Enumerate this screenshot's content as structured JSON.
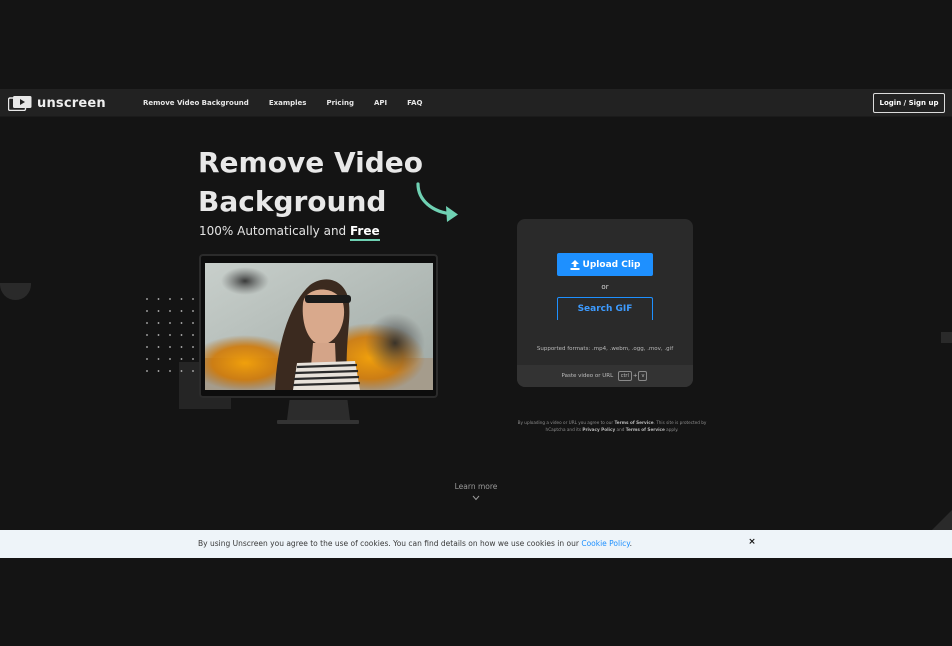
{
  "nav": {
    "logo_text": "unscreen",
    "links": [
      "Remove Video Background",
      "Examples",
      "Pricing",
      "API",
      "FAQ"
    ],
    "login_label": "Login / Sign up"
  },
  "hero": {
    "title": "Remove Video Background",
    "subtitle_prefix": "100% Automatically and ",
    "subtitle_free": "Free"
  },
  "upload": {
    "upload_label": "Upload Clip",
    "or_label": "or",
    "search_label": "Search GIF",
    "supported_formats": "Supported formats: .mp4, .webm, .ogg, .mov, .gif",
    "paste_prefix": "Paste video or URL",
    "key_ctrl": "ctrl",
    "key_plus": "+",
    "key_v": "v"
  },
  "terms": {
    "part1": "By uploading a video or URL you agree to our ",
    "terms_link": "Terms of Service",
    "part2": ". This site is protected by hCaptcha and its ",
    "privacy_link": "Privacy Policy",
    "part3": " and ",
    "terms_link2": "Terms of Service",
    "part4": " apply."
  },
  "learn_more": "Learn more",
  "cookie": {
    "text": "By using Unscreen you agree to the use of cookies. You can find details on how we use cookies in our ",
    "link": "Cookie Policy",
    "suffix": ".",
    "close_label": "×"
  },
  "colors": {
    "background": "#141414",
    "navbar": "#222222",
    "accent_blue": "#1e90ff",
    "accent_green": "#6fd1b3",
    "card": "#2a2a2a",
    "cookie_bar": "#eef4f9"
  },
  "icons": {
    "logo": "play-stack-icon",
    "arrow": "curved-arrow-icon",
    "upload": "upload-icon",
    "chevron": "chevron-down-icon",
    "close": "close-icon"
  }
}
